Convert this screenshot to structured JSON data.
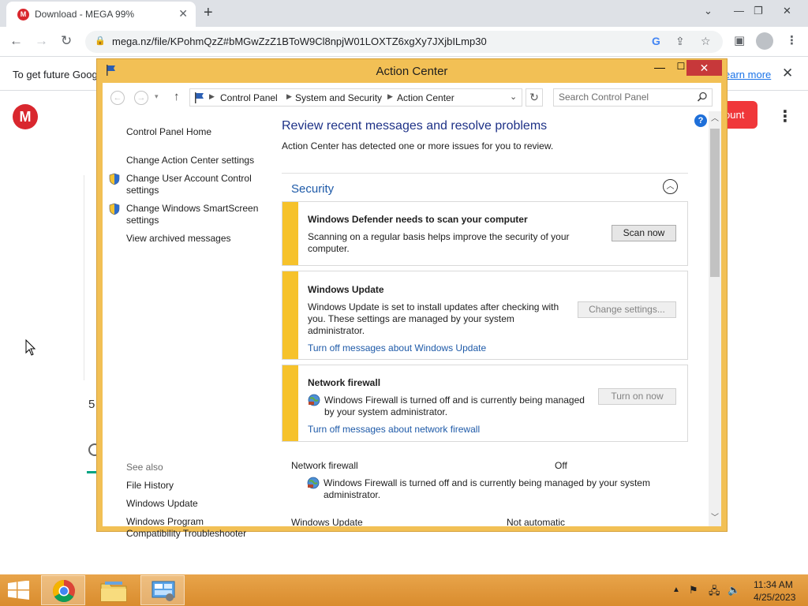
{
  "browser": {
    "tab_title": "Download - MEGA 99%",
    "tab_favicon_letter": "M",
    "url": "mega.nz/file/KPohmQzZ#bMGwZzZ1BToW9Cl8npjW01LOXTZ6xgXy7JXjbILmp30",
    "infobar_text": "To get future Goog",
    "infobar_link": "earn more"
  },
  "mega_page": {
    "logo_letter": "M",
    "account_button": "ount",
    "partial_number": "5"
  },
  "action_center": {
    "title": "Action Center",
    "breadcrumb": [
      "Control Panel",
      "System and Security",
      "Action Center"
    ],
    "search_placeholder": "Search Control Panel",
    "left_links": {
      "home": "Control Panel Home",
      "change_ac_settings": "Change Action Center settings",
      "uac_line1": "Change User Account Control",
      "uac_line2": "settings",
      "smartscreen_line1": "Change Windows SmartScreen",
      "smartscreen_line2": "settings",
      "archived": "View archived messages"
    },
    "see_also": {
      "heading": "See also",
      "file_history": "File History",
      "windows_update": "Windows Update",
      "compat_line1": "Windows Program",
      "compat_line2": "Compatibility Troubleshooter"
    },
    "main": {
      "title": "Review recent messages and resolve problems",
      "subtitle": "Action Center has detected one or more issues for you to review.",
      "section": "Security",
      "messages": [
        {
          "title": "Windows Defender needs to scan your computer",
          "body_line1": "Scanning on a regular basis helps improve the security of your",
          "body_line2": "computer.",
          "button": "Scan now"
        },
        {
          "title": "Windows Update",
          "body_line1": "Windows Update is set to install updates after checking with",
          "body_line2": "you.  These settings are managed by your system",
          "body_line3": "administrator.",
          "link": "Turn off messages about Windows Update",
          "button": "Change settings..."
        },
        {
          "title": "Network firewall",
          "body_line1": "Windows Firewall is turned off and is currently being managed",
          "body_line2": "by your system administrator.",
          "link": "Turn off messages about network firewall",
          "button": "Turn on now"
        }
      ],
      "status": [
        {
          "label": "Network firewall",
          "value": "Off",
          "body_line1": "Windows Firewall is turned off and is currently being managed by your system",
          "body_line2": "administrator."
        },
        {
          "label": "Windows Update",
          "value": "Not automatic"
        }
      ]
    }
  },
  "taskbar": {
    "time": "11:34 AM",
    "date": "4/25/2023"
  },
  "colors": {
    "window_frame": "#f2c055",
    "warning_bar": "#f6c22b",
    "link_blue": "#1e5aa8",
    "close_red": "#c7383a",
    "mega_red": "#d9272e"
  }
}
